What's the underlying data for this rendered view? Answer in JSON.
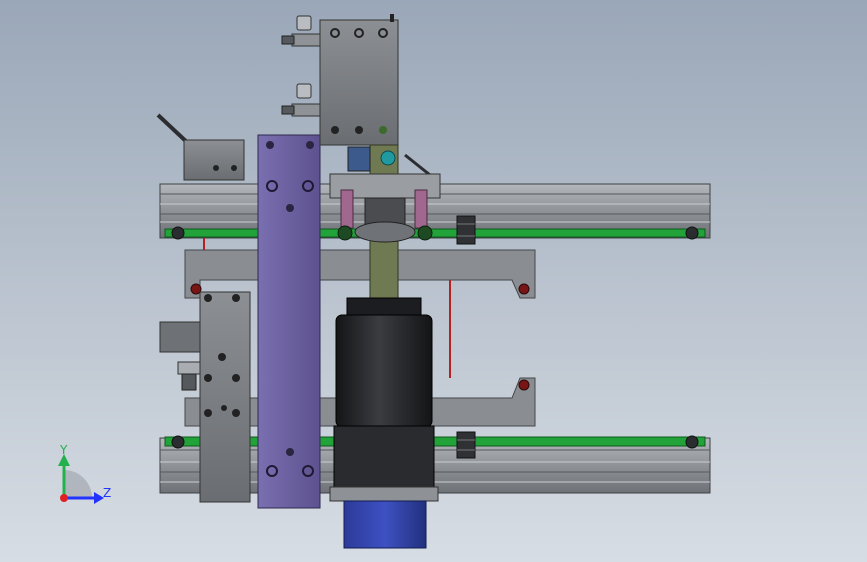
{
  "viewport": {
    "kind": "cad-3d-assembly-view",
    "colors": {
      "background_top": "#9aa7b8",
      "background_bottom": "#d7dde4",
      "aluminum_profile": "#9a9ea3",
      "profile_shadow": "#5f6368",
      "steel_part": "#7e8185",
      "purple_plate": "#6f63a3",
      "motor_body": "#1f2023",
      "motor_base": "#2f3ea0",
      "belt": "#22a33a",
      "cylinder_rod": "#a0678f",
      "wire": "#b52222"
    }
  },
  "triad": {
    "x_axis": "",
    "y_axis": "Y",
    "z_axis": "Z",
    "colors": {
      "y": "#22b14c",
      "z": "#2233ff",
      "x": "#e02020"
    }
  }
}
